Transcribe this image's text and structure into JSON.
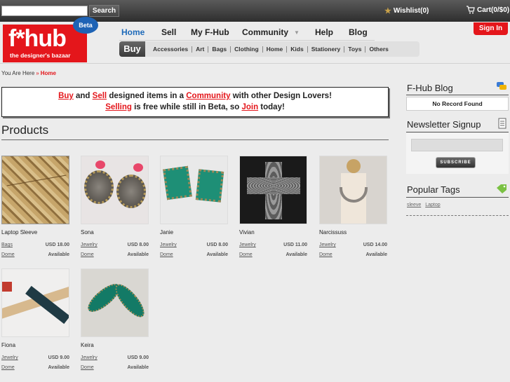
{
  "topbar": {
    "search_value": "",
    "search_button": "Search",
    "wishlist": "Wishlist(0)",
    "cart": "Cart(0/$0)"
  },
  "logo": {
    "name": "f*hub",
    "tagline": "the designer's bazaar",
    "badge": "Beta",
    "brand_color": "#e4161b"
  },
  "nav": {
    "items": [
      {
        "label": "Home"
      },
      {
        "label": "Sell"
      },
      {
        "label": "My F-Hub"
      },
      {
        "label": "Community"
      },
      {
        "label": "Help"
      },
      {
        "label": "Blog"
      }
    ],
    "signin": "Sign In"
  },
  "subnav": {
    "buy": "Buy",
    "items": [
      "Accessories",
      "Art",
      "Bags",
      "Clothing",
      "Home",
      "Kids",
      "Stationery",
      "Toys",
      "Others"
    ]
  },
  "breadcrumb": {
    "prefix": "You Are Here",
    "sep": "»",
    "current": "Home"
  },
  "promo": {
    "buy": "Buy",
    "and": " and ",
    "sell": "Sell",
    "mid": " designed items in a ",
    "community": "Community",
    "end1": " with other Design Lovers!",
    "selling": "Selling",
    "mid2": " is free while still in Beta, so ",
    "join": "Join",
    "end2": " today!"
  },
  "products": {
    "title": "Products",
    "items": [
      {
        "name": "Laptop Sleeve",
        "category": "Bags",
        "price": "USD 18.00",
        "user": "Dome",
        "status": "Available"
      },
      {
        "name": "Sona",
        "category": "Jewelry",
        "price": "USD 8.00",
        "user": "Dome",
        "status": "Available"
      },
      {
        "name": "Janie",
        "category": "Jewelry",
        "price": "USD 8.00",
        "user": "Dome",
        "status": "Available"
      },
      {
        "name": "Vivian",
        "category": "Jewelry",
        "price": "USD 11.00",
        "user": "Dome",
        "status": "Available"
      },
      {
        "name": "Narcissuss",
        "category": "Jewelry",
        "price": "USD 14.00",
        "user": "Dome",
        "status": "Available"
      },
      {
        "name": "Fiona",
        "category": "Jewelry",
        "price": "USD 9.00",
        "user": "Dome",
        "status": "Available"
      },
      {
        "name": "Keira",
        "category": "Jewelry",
        "price": "USD 9.00",
        "user": "Dome",
        "status": "Available"
      }
    ]
  },
  "sidebar": {
    "blog_title": "F-Hub Blog",
    "blog_empty": "No Record Found",
    "newsletter_title": "Newsletter Signup",
    "subscribe": "SUBSCRIBE",
    "tags_title": "Popular Tags",
    "tags": [
      "sleeve",
      "Laptop"
    ]
  }
}
